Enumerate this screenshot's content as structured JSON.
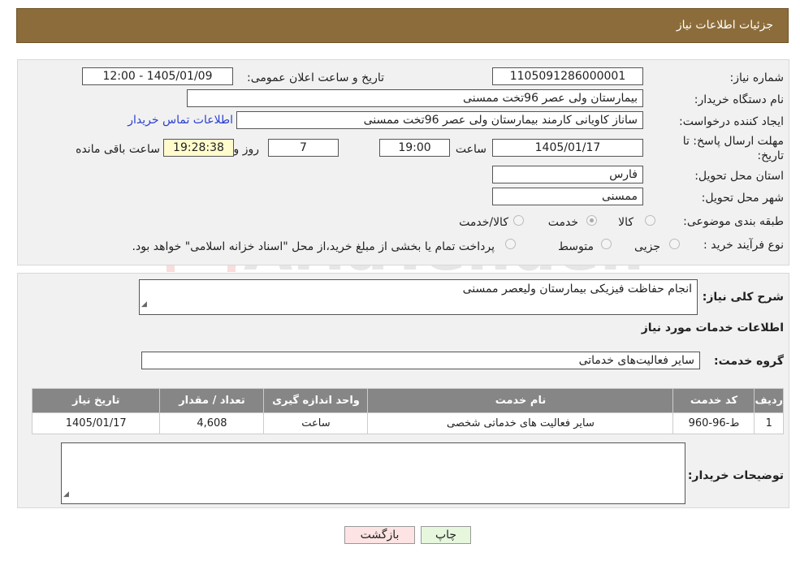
{
  "header": {
    "title": "جزئیات اطلاعات نیاز"
  },
  "fields": {
    "need_number_label": "شماره نیاز:",
    "need_number": "1105091286000001",
    "announce_label": "تاریخ و ساعت اعلان عمومی:",
    "announce_value": "1405/01/09 - 12:00",
    "buyer_org_label": "نام دستگاه خریدار:",
    "buyer_org": "بیمارستان ولی عصر  96تخت ممسنی",
    "creator_label": "ایجاد کننده درخواست:",
    "creator": "ساناز کاویانی کارمند بیمارستان ولی عصر  96تخت ممسنی",
    "contact_link": "اطلاعات تماس خریدار",
    "deadline_label_1": "مهلت ارسال پاسخ: تا",
    "deadline_label_2": "تاریخ:",
    "deadline_date": "1405/01/17",
    "time_label": "ساعت",
    "deadline_time": "19:00",
    "days_value": "7",
    "days_label": "روز و",
    "remaining_time": "19:28:38",
    "remaining_label": "ساعت باقی مانده",
    "province_label": "استان محل تحویل:",
    "province": "فارس",
    "city_label": "شهر محل تحویل:",
    "city": "ممسنی",
    "category_label": "طبقه بندی موضوعی:",
    "category_options": [
      "کالا",
      "خدمت",
      "کالا/خدمت"
    ],
    "category_selected": "خدمت",
    "process_label": "نوع فرآیند خرید :",
    "process_options": [
      "جزیی",
      "متوسط"
    ],
    "process_note": "پرداخت تمام یا بخشی از مبلغ خرید،از محل \"اسناد خزانه اسلامی\" خواهد بود."
  },
  "details": {
    "desc_label": "شرح کلی نیاز:",
    "desc_value": "انجام حفاظت فیزیکی بیمارستان ولیعصر ممسنی",
    "services_title": "اطلاعات خدمات مورد نیاز",
    "group_label": "گروه خدمت:",
    "group_value": "سایر فعالیت‌های خدماتی",
    "table": {
      "headers": [
        "ردیف",
        "کد خدمت",
        "نام خدمت",
        "واحد اندازه گیری",
        "تعداد / مقدار",
        "تاریخ نیاز"
      ],
      "rows": [
        [
          "1",
          "ط-96-960",
          "سایر فعالیت های خدماتی شخصی",
          "ساعت",
          "4,608",
          "1405/01/17"
        ]
      ]
    },
    "buyer_notes_label": "توضیحات خریدار:",
    "buyer_notes_value": ""
  },
  "buttons": {
    "print": "چاپ",
    "back": "بازگشت"
  },
  "colors": {
    "header_bg": "#8c6c3a",
    "table_header_bg": "#868686",
    "back_button_bg": "#fde3e3",
    "print_button_bg": "#e6f7de"
  }
}
